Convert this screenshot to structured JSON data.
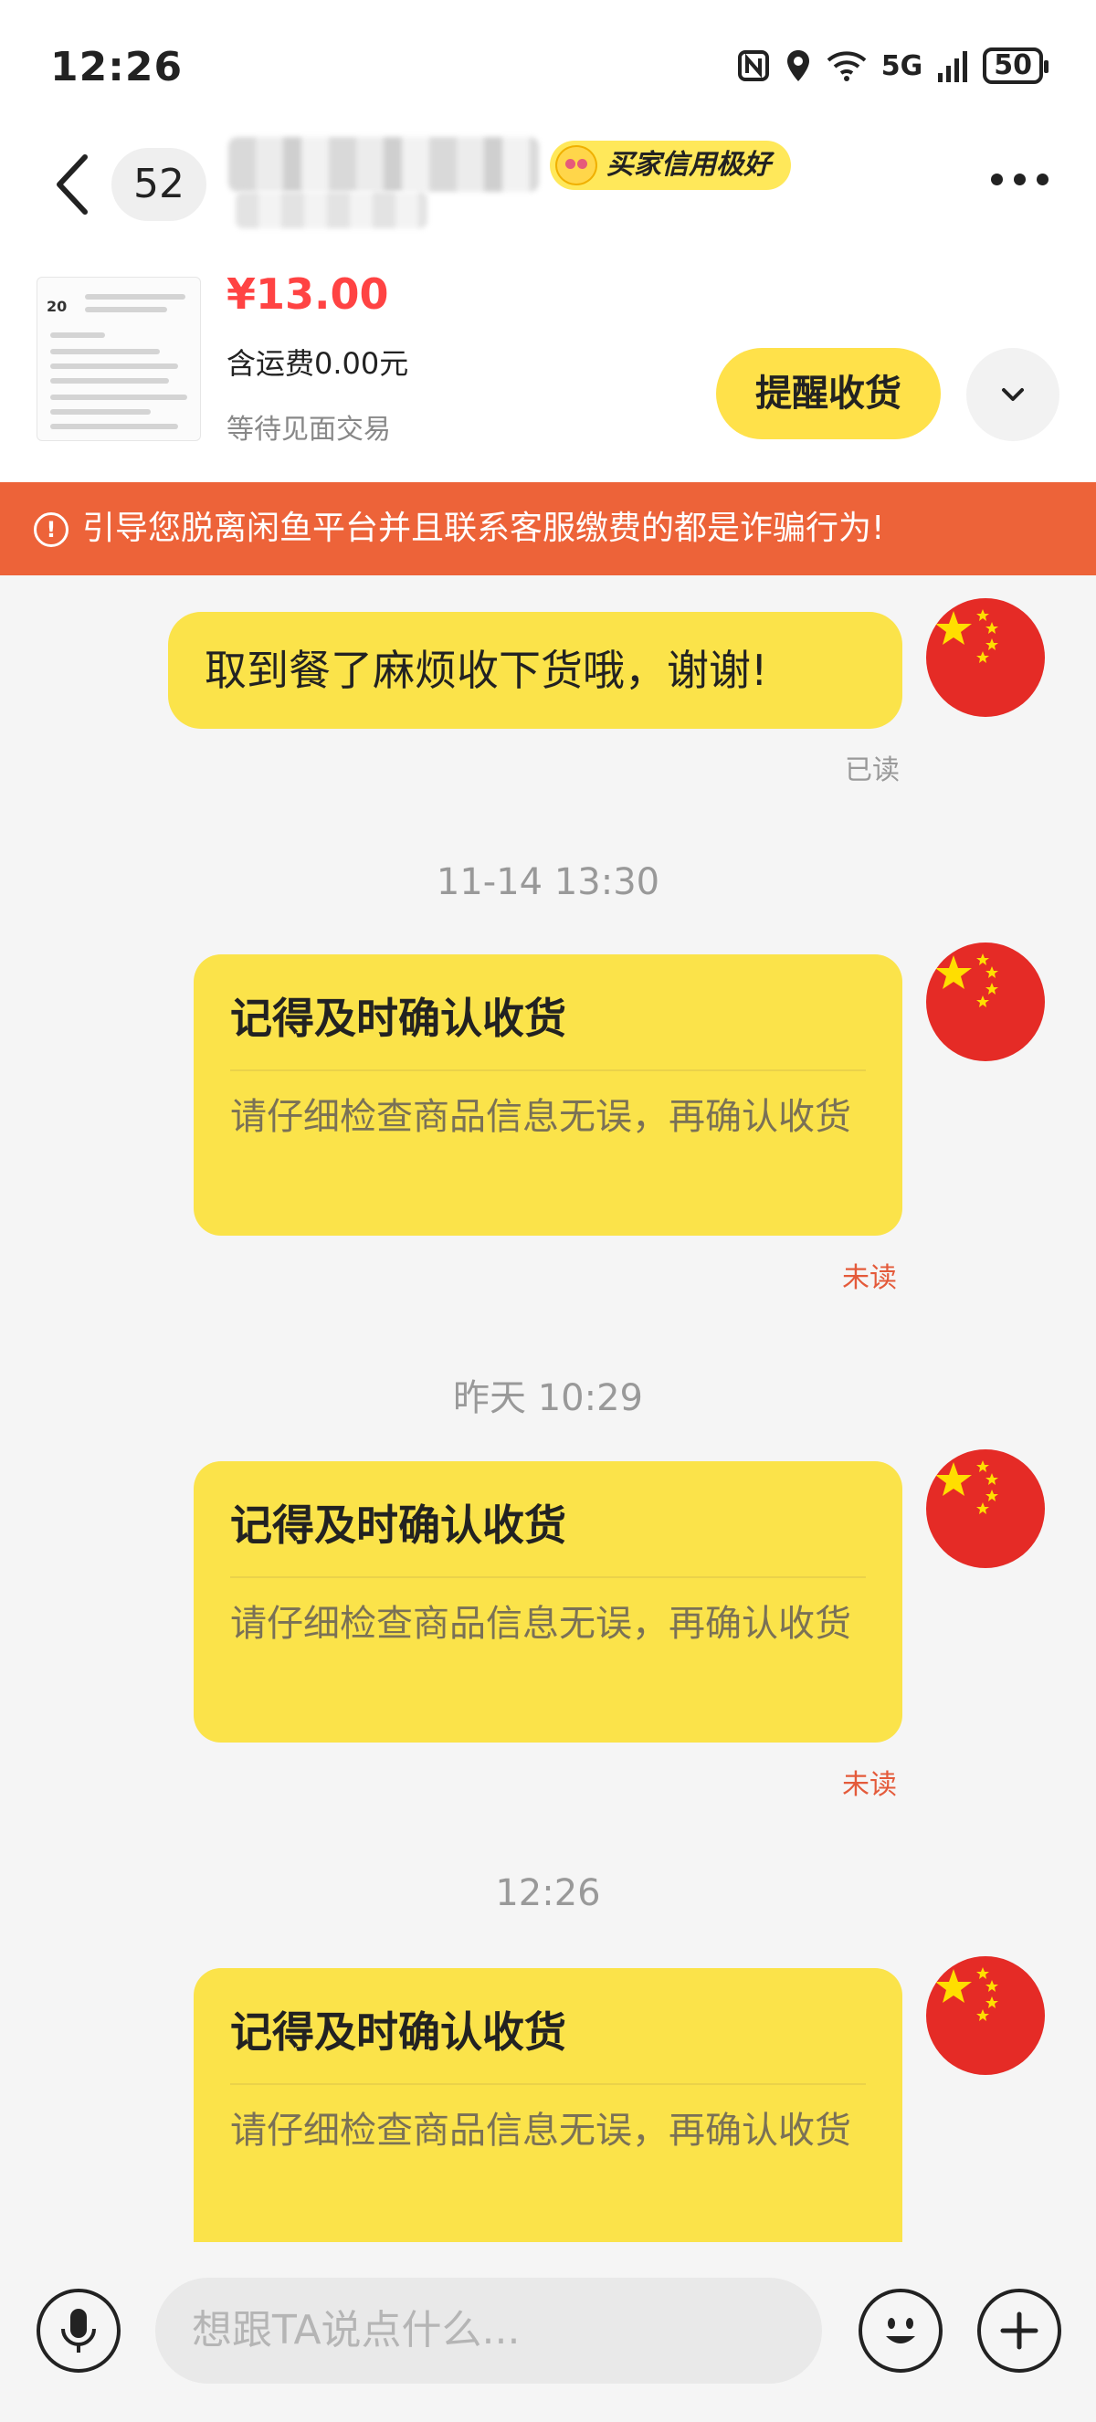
{
  "status_bar": {
    "time": "12:26",
    "network": "5G",
    "battery": "50"
  },
  "header": {
    "unread_count": "52",
    "credit_badge": "买家信用极好"
  },
  "product": {
    "thumb_label": "20",
    "price": "¥13.00",
    "shipping": "含运费0.00元",
    "status": "等待见面交易",
    "remind_button": "提醒收货"
  },
  "warning": {
    "text": "引导您脱离闲鱼平台并且联系客服缴费的都是诈骗行为!"
  },
  "messages": {
    "first": {
      "text": "取到餐了麻烦收下货哦，谢谢!",
      "status": "已读"
    },
    "cards": [
      {
        "timestamp": "11-14 13:30",
        "title": "记得及时确认收货",
        "body": "请仔细检查商品信息无误，再确认收货",
        "status": "未读"
      },
      {
        "timestamp": "昨天 10:29",
        "title": "记得及时确认收货",
        "body": "请仔细检查商品信息无误，再确认收货",
        "status": "未读"
      },
      {
        "timestamp": "12:26",
        "title": "记得及时确认收货",
        "body": "请仔细检查商品信息无误，再确认收货"
      }
    ]
  },
  "input": {
    "placeholder": "想跟TA说点什么..."
  },
  "colors": {
    "accent_yellow": "#fbe34a",
    "warning_orange": "#ed6339",
    "price_red": "#ff4343"
  }
}
